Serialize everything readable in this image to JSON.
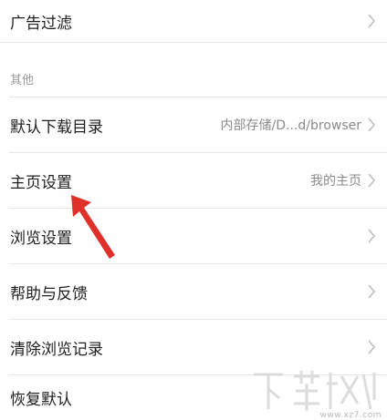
{
  "rows": {
    "ad_filter": {
      "label": "广告过滤"
    },
    "section_other": {
      "label": "其他"
    },
    "download_dir": {
      "label": "默认下载目录",
      "value": "内部存储/D...d/browser"
    },
    "homepage": {
      "label": "主页设置",
      "value": "我的主页"
    },
    "browse": {
      "label": "浏览设置"
    },
    "help": {
      "label": "帮助与反馈"
    },
    "clear_history": {
      "label": "清除浏览记录"
    },
    "restore_default": {
      "label": "恢复默认"
    }
  },
  "watermark": {
    "text": "www.xz7.com"
  },
  "colors": {
    "arrow": "#e0302a",
    "divider": "#e6e6e6",
    "chevron": "#bdbdbd"
  },
  "icons": {
    "chevron": "chevron-right-icon",
    "annotation": "red-arrow-icon",
    "watermark": "download-site-logo"
  }
}
